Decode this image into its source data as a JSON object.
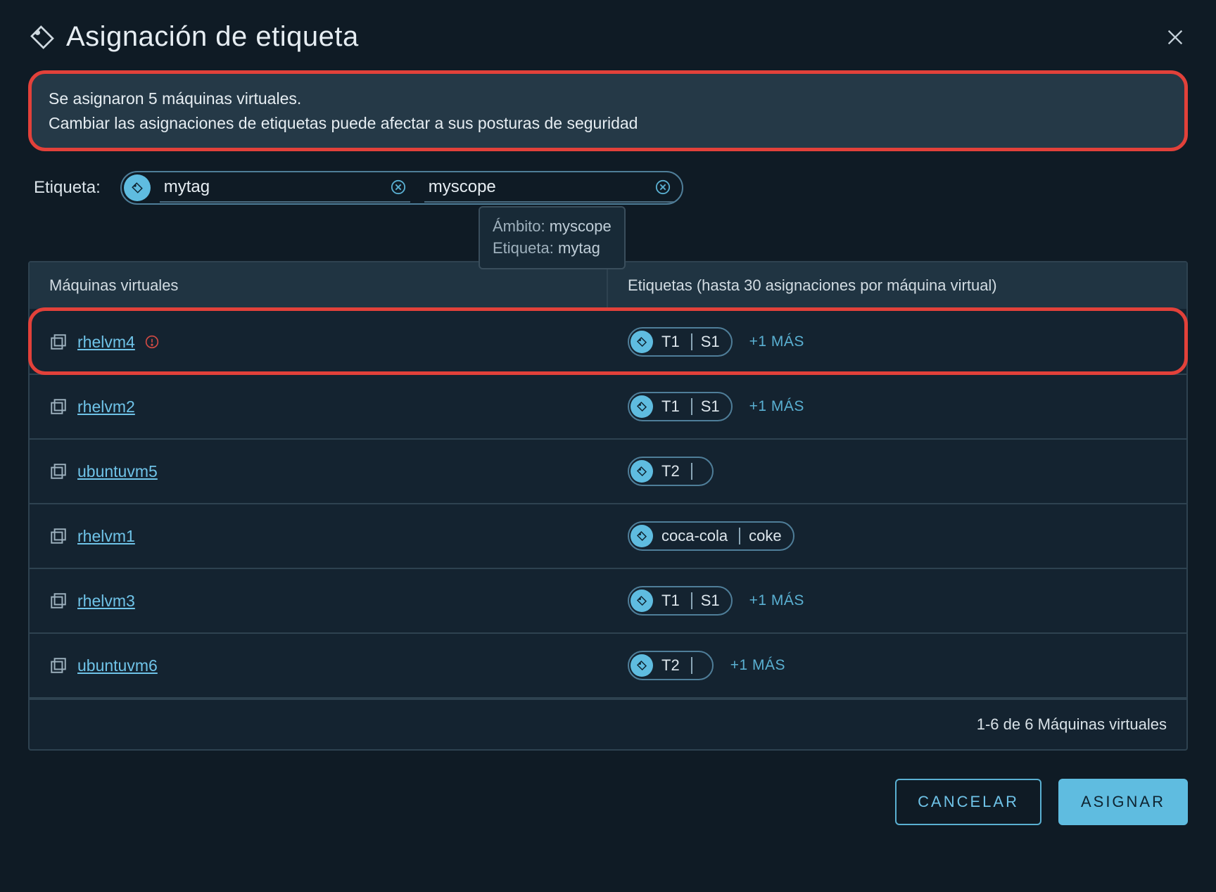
{
  "dialog": {
    "title": "Asignación de etiqueta"
  },
  "alert": {
    "line1": "Se asignaron 5 máquinas virtuales.",
    "line2": "Cambiar las asignaciones de etiquetas puede afectar a sus posturas de seguridad"
  },
  "tag_editor": {
    "label": "Etiqueta:",
    "tag_value": "mytag",
    "scope_value": "myscope"
  },
  "tooltip": {
    "scope_label": "Ámbito:",
    "scope_value": "myscope",
    "tag_label": "Etiqueta:",
    "tag_value": "mytag"
  },
  "table": {
    "headers": {
      "vm": "Máquinas virtuales",
      "tags": "Etiquetas (hasta 30 asignaciones por máquina virtual)"
    },
    "rows": [
      {
        "name": "rhelvm4",
        "alert": true,
        "chip": {
          "tag": "T1",
          "scope": "S1"
        },
        "more": "+1 MÁS",
        "highlight": true
      },
      {
        "name": "rhelvm2",
        "alert": false,
        "chip": {
          "tag": "T1",
          "scope": "S1"
        },
        "more": "+1 MÁS",
        "highlight": false
      },
      {
        "name": "ubuntuvm5",
        "alert": false,
        "chip": {
          "tag": "T2",
          "scope": ""
        },
        "more": "",
        "highlight": false
      },
      {
        "name": "rhelvm1",
        "alert": false,
        "chip": {
          "tag": "coca-cola",
          "scope": "coke"
        },
        "more": "",
        "highlight": false
      },
      {
        "name": "rhelvm3",
        "alert": false,
        "chip": {
          "tag": "T1",
          "scope": "S1"
        },
        "more": "+1 MÁS",
        "highlight": false
      },
      {
        "name": "ubuntuvm6",
        "alert": false,
        "chip": {
          "tag": "T2",
          "scope": ""
        },
        "more": "+1 MÁS",
        "highlight": false
      }
    ],
    "footer": "1-6 de 6 Máquinas virtuales"
  },
  "buttons": {
    "cancel": "CANCELAR",
    "assign": "ASIGNAR"
  }
}
